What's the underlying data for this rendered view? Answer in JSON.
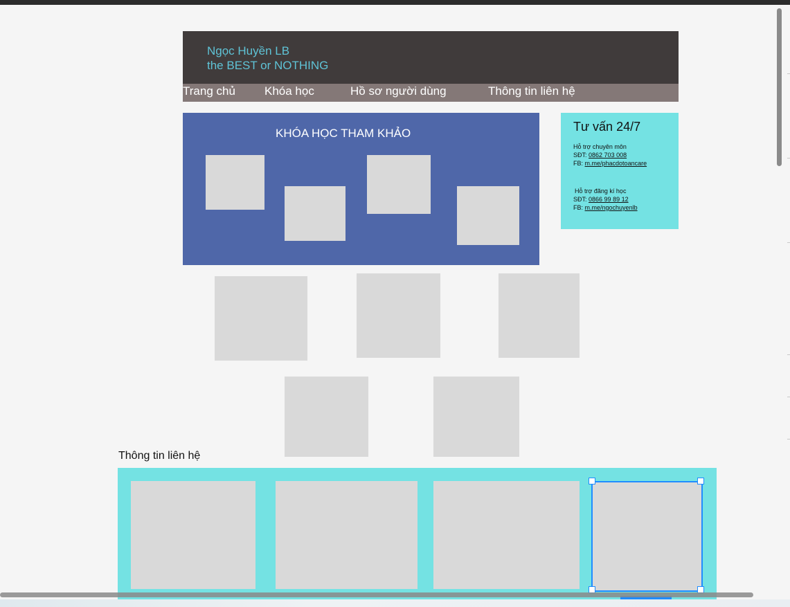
{
  "brand": {
    "line1": "Ngọc Huyền LB",
    "line2": "the BEST or NOTHING"
  },
  "nav": [
    "Trang chủ",
    "Khóa học",
    "Hồ sơ người dùng",
    "Thông tin liên hệ"
  ],
  "main_panel": {
    "title": "KHÓA HỌC THAM KHẢO"
  },
  "sidebox": {
    "title": "Tư vấn 24/7",
    "group1": {
      "heading": "Hỗ trợ chuyên môn",
      "phone_label": "SĐT:",
      "phone": "0862 703 008",
      "fb_label": "FB:",
      "fb": "m.me/phacdotoancare"
    },
    "group2": {
      "heading": "Hỗ trợ đăng kí học",
      "phone_label": "SĐT:",
      "phone": "0866 99 89 12",
      "fb_label": "FB:",
      "fb": "m.me/ngochuyenlb"
    }
  },
  "contact": {
    "label": "Thông tin liên hệ"
  },
  "colors": {
    "header_bg": "#403b3b",
    "nav_bg": "#847877",
    "brand_text": "#5fc3d6",
    "panel_bg": "#4f67a9",
    "cyan_bg": "#74e2e3",
    "placeholder": "#d9d9d9",
    "selection": "#1f8cff"
  }
}
